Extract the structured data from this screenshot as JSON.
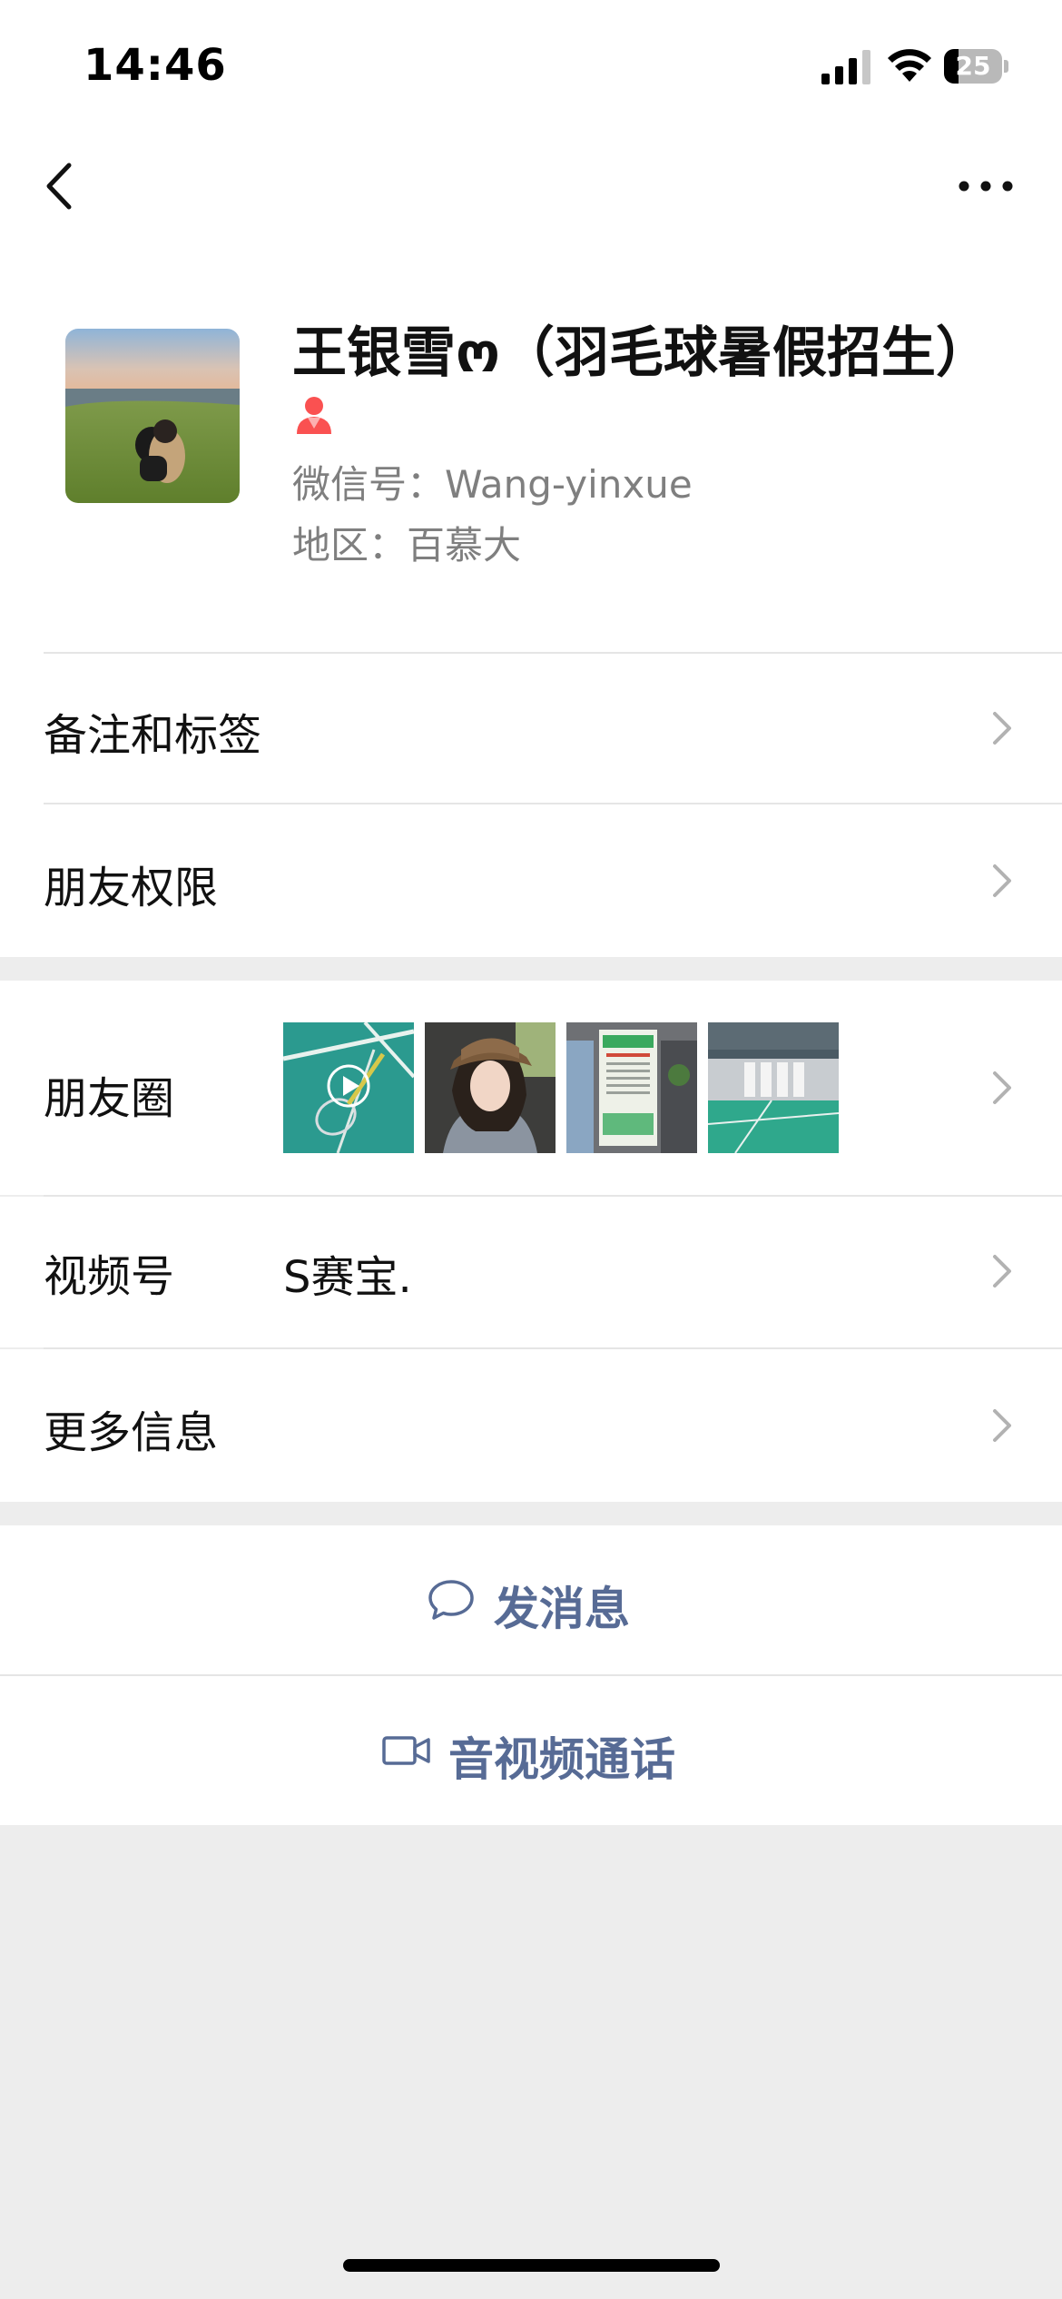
{
  "status_bar": {
    "time": "14:46",
    "battery_level": "25",
    "battery_fraction": 0.25,
    "icons": [
      "signal-icon",
      "wifi-icon",
      "battery-icon"
    ]
  },
  "nav": {
    "back_icon": "chevron-left-icon",
    "more_icon": "more-dots-icon"
  },
  "profile": {
    "name": "王银雪ო（羽毛球暑假招生）",
    "gender_icon": "female-icon",
    "gender_color": "#fa5151",
    "wechat_id": "微信号：Wang-yinxue",
    "region": "地区：百慕大"
  },
  "rows": {
    "remark": {
      "label": "备注和标签"
    },
    "permissions": {
      "label": "朋友权限"
    },
    "moments": {
      "label": "朋友圈",
      "thumbnails": [
        "badminton-court-video",
        "selfie-in-car",
        "poster-board",
        "sports-hall"
      ]
    },
    "channels": {
      "label": "视频号",
      "value": "S赛宝."
    },
    "more_info": {
      "label": "更多信息"
    }
  },
  "actions": {
    "message": {
      "label": "发消息",
      "icon": "chat-bubble-icon"
    },
    "call": {
      "label": "音视频通话",
      "icon": "video-camera-icon"
    }
  },
  "colors": {
    "link_blue": "#576b95",
    "background": "#ededed",
    "chevron": "#b2b2b2"
  }
}
